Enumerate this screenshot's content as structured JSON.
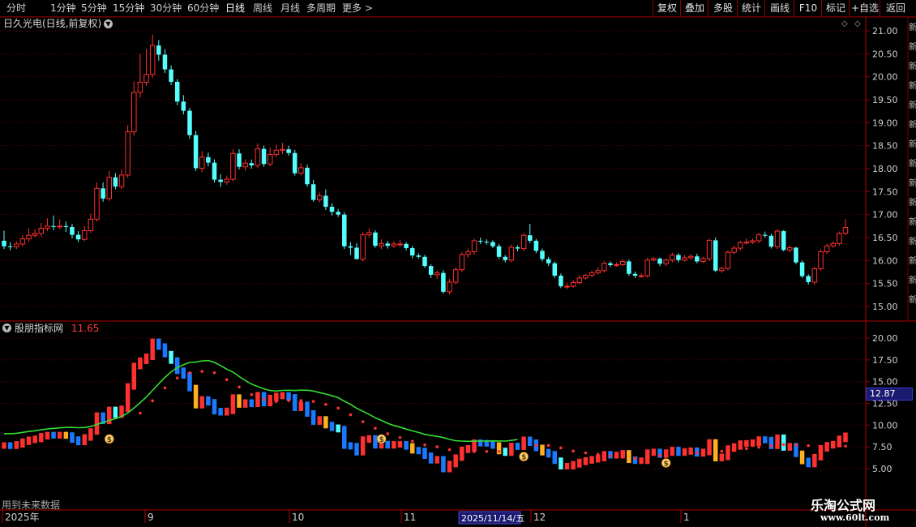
{
  "toolbar": {
    "periods": [
      {
        "label": "分时",
        "active": false
      },
      {
        "label": "1分钟",
        "active": false
      },
      {
        "label": "5分钟",
        "active": false
      },
      {
        "label": "15分钟",
        "active": false
      },
      {
        "label": "30分钟",
        "active": false
      },
      {
        "label": "60分钟",
        "active": false
      },
      {
        "label": "日线",
        "active": true
      },
      {
        "label": "周线",
        "active": false
      },
      {
        "label": "月线",
        "active": false
      },
      {
        "label": "多周期",
        "active": false
      },
      {
        "label": "更多",
        "active": false
      }
    ],
    "more_chevron": ">",
    "actions": [
      "复权",
      "叠加",
      "多股",
      "统计",
      "画线",
      "F10",
      "标记",
      "+自选",
      "返回"
    ]
  },
  "main_chart": {
    "title": "日久光电(日线,前复权)",
    "y_ticks": [
      "21.00",
      "20.50",
      "20.00",
      "19.50",
      "19.00",
      "18.50",
      "18.00",
      "17.50",
      "17.00",
      "16.50",
      "16.00",
      "15.50",
      "15.00"
    ],
    "right_edge_chars": [
      "新",
      "新",
      "新",
      "新",
      "新",
      "新",
      "新",
      "新",
      "新",
      "新",
      "新",
      "新",
      "新",
      "新",
      "新"
    ]
  },
  "indicator": {
    "title": "股朋指标网",
    "value": "11.65",
    "y_ticks": [
      "20.00",
      "17.50",
      "15.00",
      "12.50",
      "10.00",
      "7.50",
      "5.00"
    ],
    "current_price": "12.87",
    "future_note": "用到未来数据"
  },
  "x_axis": {
    "labels": [
      "2025年",
      "9",
      "10",
      "11",
      "12",
      "1"
    ],
    "cursor_date": "2025/11/14/五"
  },
  "watermark": {
    "name": "乐淘公式网",
    "url": "www.60lt.com"
  },
  "colors": {
    "up": "#ff3030",
    "down": "#54ffff",
    "grid": "#7a0000",
    "axis": "#9a0000",
    "ma_green": "#33dd33",
    "dots": "#ff3333",
    "blue": "#1a7aff",
    "gold": "#ffb020"
  },
  "chart_data": {
    "type": "candlestick",
    "title": "日久光电(日线,前复权)",
    "ylim": [
      14.8,
      21.2
    ],
    "open": [
      16.43,
      16.31,
      16.3,
      16.36,
      16.47,
      16.55,
      16.59,
      16.7,
      16.75,
      16.74,
      16.75,
      16.73,
      16.56,
      16.46,
      16.65,
      16.9,
      17.57,
      17.35,
      17.81,
      17.61,
      17.86,
      18.8,
      19.66,
      19.88,
      20.05,
      20.68,
      20.48,
      20.16,
      19.89,
      19.46,
      19.26,
      18.73,
      18.01,
      18.25,
      18.13,
      17.76,
      17.71,
      17.77,
      18.33,
      18.04,
      18.12,
      18.07,
      18.43,
      18.1,
      18.31,
      18.4,
      18.42,
      18.34,
      17.9,
      18.02,
      17.66,
      17.32,
      17.41,
      17.17,
      17.06,
      17.0,
      16.31,
      16.28,
      16.03,
      16.56,
      16.61,
      16.32,
      16.37,
      16.32,
      16.36,
      16.36,
      16.27,
      16.11,
      16.08,
      15.88,
      15.69,
      15.73,
      15.32,
      15.53,
      15.8,
      16.13,
      16.19,
      16.43,
      16.41,
      16.4,
      16.31,
      16.08,
      16.01,
      16.29,
      16.26,
      16.55,
      16.43,
      16.21,
      16.03,
      15.94,
      15.67,
      15.44,
      15.44,
      15.52,
      15.62,
      15.68,
      15.73,
      15.78,
      15.94,
      15.9,
      15.91,
      15.98,
      15.71,
      15.67,
      15.67,
      16.01,
      16.04,
      15.93,
      16.01,
      16.12,
      16.01,
      16.06,
      16.09,
      15.98,
      16.04,
      16.44,
      15.78,
      15.83,
      16.18,
      16.27,
      16.39,
      16.4,
      16.43,
      16.56,
      16.54,
      16.3,
      16.64,
      16.23,
      16.28,
      15.96,
      15.66,
      15.53,
      15.82,
      16.19,
      16.32,
      16.37,
      16.59
    ],
    "close": [
      16.31,
      16.3,
      16.36,
      16.47,
      16.55,
      16.59,
      16.7,
      16.75,
      16.74,
      16.75,
      16.73,
      16.56,
      16.46,
      16.65,
      16.9,
      17.57,
      17.35,
      17.81,
      17.61,
      17.86,
      18.8,
      19.66,
      19.88,
      20.05,
      20.68,
      20.48,
      20.16,
      19.89,
      19.46,
      19.26,
      18.73,
      18.01,
      18.25,
      18.13,
      17.76,
      17.71,
      17.77,
      18.33,
      18.04,
      18.12,
      18.07,
      18.43,
      18.1,
      18.31,
      18.4,
      18.42,
      18.34,
      17.9,
      18.02,
      17.66,
      17.32,
      17.41,
      17.17,
      17.06,
      17.0,
      16.31,
      16.28,
      16.03,
      16.56,
      16.61,
      16.32,
      16.37,
      16.32,
      16.36,
      16.36,
      16.27,
      16.11,
      16.08,
      15.88,
      15.69,
      15.73,
      15.32,
      15.53,
      15.8,
      16.13,
      16.19,
      16.43,
      16.41,
      16.4,
      16.31,
      16.08,
      16.01,
      16.29,
      16.26,
      16.55,
      16.43,
      16.21,
      16.03,
      15.94,
      15.67,
      15.44,
      15.44,
      15.52,
      15.62,
      15.68,
      15.73,
      15.78,
      15.94,
      15.9,
      15.91,
      15.98,
      15.71,
      15.67,
      15.67,
      16.01,
      16.04,
      15.93,
      16.01,
      16.12,
      16.01,
      16.06,
      16.09,
      15.98,
      16.04,
      16.44,
      15.78,
      15.83,
      16.18,
      16.27,
      16.39,
      16.4,
      16.43,
      16.56,
      16.54,
      16.3,
      16.64,
      16.23,
      16.28,
      15.96,
      15.66,
      15.53,
      15.82,
      16.19,
      16.32,
      16.37,
      16.59,
      16.72
    ],
    "high": [
      16.65,
      16.4,
      16.42,
      16.55,
      16.7,
      16.68,
      16.82,
      16.92,
      16.98,
      16.9,
      16.85,
      16.8,
      16.64,
      16.75,
      17.02,
      17.7,
      17.7,
      17.95,
      17.9,
      17.98,
      18.95,
      19.9,
      20.5,
      20.6,
      20.92,
      20.8,
      20.6,
      20.25,
      19.95,
      19.6,
      19.32,
      18.82,
      18.38,
      18.35,
      18.2,
      17.88,
      17.85,
      18.42,
      18.42,
      18.2,
      18.2,
      18.55,
      18.5,
      18.46,
      18.52,
      18.56,
      18.5,
      18.41,
      18.12,
      18.09,
      17.75,
      17.48,
      17.55,
      17.25,
      17.12,
      17.05,
      16.4,
      16.38,
      16.63,
      16.7,
      16.66,
      16.46,
      16.43,
      16.42,
      16.45,
      16.4,
      16.32,
      16.16,
      16.12,
      15.92,
      15.78,
      15.79,
      15.6,
      15.85,
      16.18,
      16.26,
      16.48,
      16.5,
      16.46,
      16.44,
      16.36,
      16.12,
      16.35,
      16.33,
      16.6,
      16.8,
      16.47,
      16.26,
      16.08,
      15.98,
      15.72,
      15.5,
      15.58,
      15.68,
      15.71,
      15.78,
      15.85,
      15.98,
      15.98,
      15.96,
      16.02,
      16.02,
      15.76,
      15.72,
      16.06,
      16.08,
      16.07,
      16.05,
      16.17,
      16.16,
      16.12,
      16.14,
      16.15,
      16.08,
      16.47,
      16.5,
      15.87,
      16.22,
      16.32,
      16.43,
      16.48,
      16.47,
      16.6,
      16.63,
      16.58,
      16.68,
      16.66,
      16.33,
      16.3,
      16.0,
      15.7,
      15.86,
      16.24,
      16.36,
      16.42,
      16.63,
      16.9
    ],
    "low": [
      16.25,
      16.22,
      16.25,
      16.3,
      16.4,
      16.5,
      16.52,
      16.64,
      16.66,
      16.68,
      16.62,
      16.48,
      16.4,
      16.42,
      16.6,
      16.85,
      17.28,
      17.3,
      17.55,
      17.56,
      17.8,
      18.72,
      19.55,
      19.8,
      19.98,
      20.35,
      20.08,
      19.82,
      19.38,
      19.18,
      18.65,
      17.95,
      17.92,
      18.05,
      17.7,
      17.6,
      17.65,
      17.72,
      17.98,
      17.95,
      18.0,
      18.02,
      18.04,
      18.05,
      18.25,
      18.32,
      18.28,
      17.85,
      17.85,
      17.6,
      17.28,
      17.26,
      17.1,
      16.98,
      16.95,
      16.25,
      16.12,
      16.1,
      15.98,
      16.5,
      16.28,
      16.25,
      16.26,
      16.28,
      16.3,
      16.22,
      16.05,
      16.04,
      15.84,
      15.62,
      15.6,
      15.28,
      15.26,
      15.48,
      15.75,
      16.06,
      16.13,
      16.36,
      16.35,
      16.27,
      16.03,
      15.96,
      15.96,
      16.2,
      16.2,
      16.38,
      16.16,
      15.98,
      15.88,
      15.62,
      15.4,
      15.38,
      15.4,
      15.48,
      15.58,
      15.64,
      15.7,
      15.74,
      15.86,
      15.87,
      15.88,
      15.66,
      15.62,
      15.62,
      15.62,
      15.98,
      15.88,
      15.88,
      15.96,
      15.96,
      15.98,
      16.02,
      15.94,
      15.95,
      15.99,
      15.75,
      15.73,
      15.78,
      16.14,
      16.22,
      16.35,
      16.36,
      16.38,
      16.5,
      16.26,
      16.25,
      16.2,
      16.18,
      15.92,
      15.62,
      15.48,
      15.47,
      15.78,
      16.14,
      16.28,
      16.32,
      16.55
    ]
  }
}
